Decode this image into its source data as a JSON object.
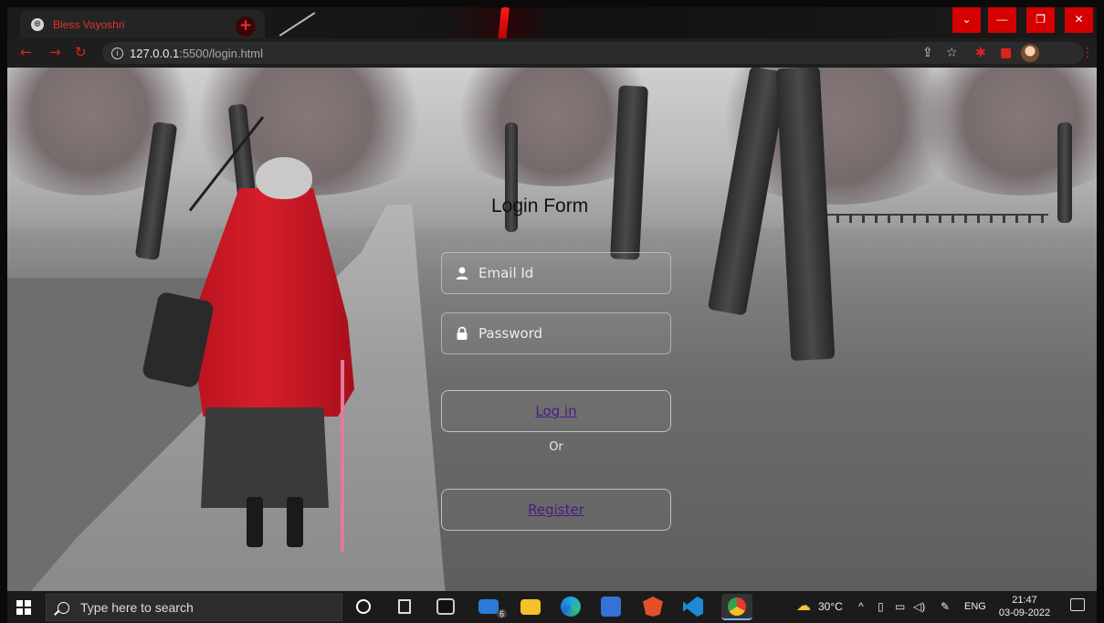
{
  "browser": {
    "tab_title": "Bless Vayoshri",
    "tab_close": "×",
    "new_tab": "+",
    "url_host": "127.0.0.1",
    "url_path": ":5500/login.html",
    "window_controls": {
      "minimize": "—",
      "restore": "❐",
      "close": "✕",
      "tab_search": "⌄"
    }
  },
  "login": {
    "title": "Login Form",
    "email_placeholder": "Email Id",
    "password_placeholder": "Password",
    "login_label": "Log in",
    "or_text": "Or",
    "register_label": "Register"
  },
  "taskbar": {
    "search_placeholder": "Type here to search",
    "mail_badge": "6",
    "weather": "30°C",
    "language": "ENG",
    "time": "21:47",
    "date": "03-09-2022"
  },
  "colors": {
    "accent_red": "#e0221f",
    "coat_red": "#d61e2b",
    "link_purple": "#4b1b86"
  }
}
